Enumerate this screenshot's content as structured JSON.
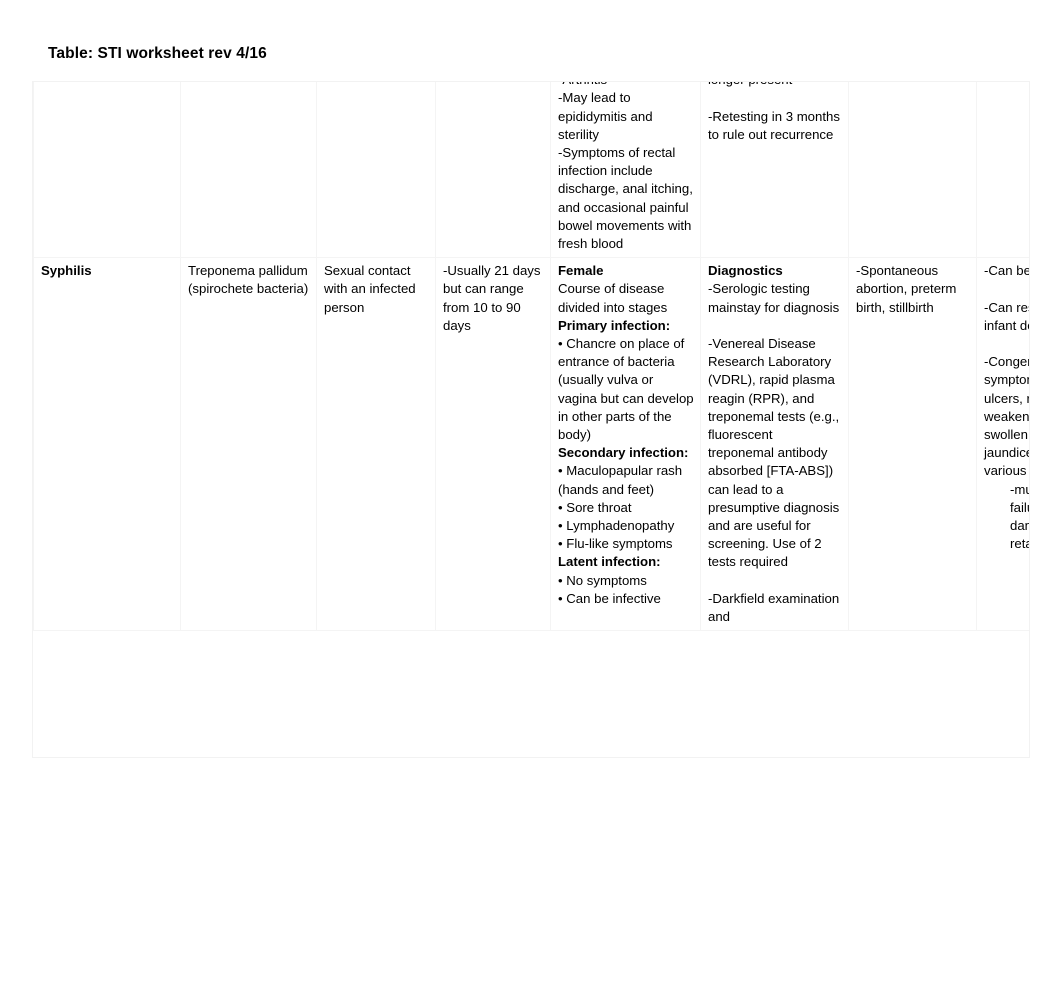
{
  "document": {
    "title": "Table: STI worksheet rev 4/16"
  },
  "table": {
    "columns": [
      "infection",
      "organism",
      "transmission",
      "incubation",
      "symptoms",
      "diagnostics",
      "maternal_effects",
      "fetal_newborn_effects"
    ],
    "rows": [
      {
        "infection": "",
        "organism": "",
        "transmission": "",
        "incubation": "",
        "symptoms": "-Penile discharge (pus)\n-Arthritis\n-May lead to epididymitis and sterility\n-Symptoms of rectal infection include discharge, anal itching, and occasional painful bowel movements with fresh blood",
        "diagnostics": "and symptoms no longer present\n\n-Retesting in 3 months to rule out recurrence",
        "maternal_effects": "",
        "fetal_newborn_effects": ""
      },
      {
        "infection": "Syphilis",
        "organism": "Treponema pallidum (spirochete bacteria)",
        "transmission": "Sexual contact with an infected person",
        "incubation": "-Usually 21 days but can range from 10 to 90 days",
        "symptoms_blocks": [
          {
            "style": "bold",
            "text": "Female"
          },
          {
            "style": "normal",
            "text": "Course of disease divided into stages"
          },
          {
            "style": "bold",
            "text": "Primary infection:"
          },
          {
            "style": "normal",
            "text": "• Chancre on place of entrance of bacteria (usually vulva or vagina but can develop in other parts of the body)"
          },
          {
            "style": "bold",
            "text": "Secondary infection:"
          },
          {
            "style": "normal",
            "text": "• Maculopapular rash (hands and feet)"
          },
          {
            "style": "normal",
            "text": "• Sore throat"
          },
          {
            "style": "normal",
            "text": "• Lymphadenopathy"
          },
          {
            "style": "normal",
            "text": "• Flu-like symptoms"
          },
          {
            "style": "bold",
            "text": "Latent infection:"
          },
          {
            "style": "normal",
            "text": "• No symptoms"
          },
          {
            "style": "normal",
            "text": "• Can be infective"
          }
        ],
        "diagnostics_blocks": [
          {
            "style": "bold",
            "text": "Diagnostics"
          },
          {
            "style": "normal",
            "text": "-Serologic testing mainstay for diagnosis"
          },
          {
            "style": "blank",
            "text": ""
          },
          {
            "style": "normal",
            "text": "-Venereal Disease Research Laboratory (VDRL), rapid plasma reagin (RPR), and treponemal tests (e.g., fluorescent treponemal antibody absorbed [FTA-ABS]) can lead to a presumptive diagnosis and are useful for screening. Use of 2 tests required"
          },
          {
            "style": "blank",
            "text": ""
          },
          {
            "style": "normal",
            "text": "-Darkfield examination and"
          }
        ],
        "maternal_effects": "-Spontaneous abortion, preterm birth, stillbirth",
        "fetal_newborn_blocks": [
          {
            "style": "normal",
            "text": "-Can be passed in utero"
          },
          {
            "style": "blank",
            "text": ""
          },
          {
            "style": "normal",
            "text": "-Can result in fetal or infant death"
          },
          {
            "style": "blank",
            "text": ""
          },
          {
            "style": "normal",
            "text": "-Congenital syphilis symptoms include skin ulcers, rashes, fever, weakened or hoarse cry, swollen liver and spleen, jaundice and anemia, various deformations"
          },
          {
            "style": "indent",
            "text": "-multisystem organ failure, structural damage, mental retardation"
          }
        ]
      }
    ]
  }
}
